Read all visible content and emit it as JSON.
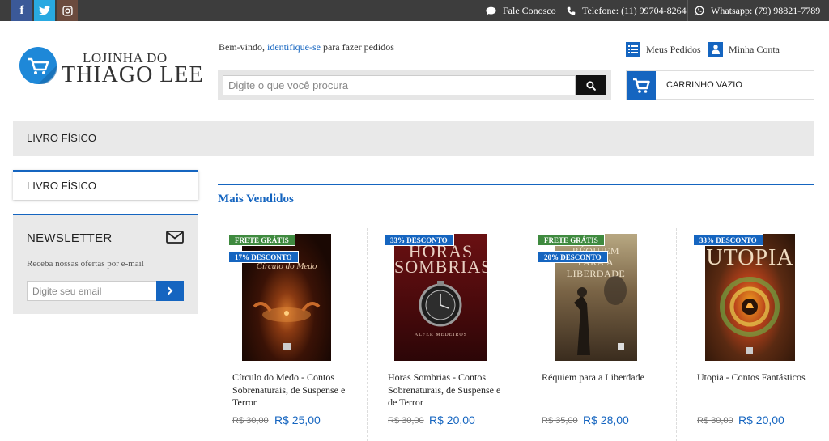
{
  "topbar": {
    "social": [
      "f",
      "twitter-icon",
      "instagram-icon"
    ],
    "contact_label": "Fale Conosco",
    "phone_label": "Telefone: (11) 99704-8264",
    "whatsapp_label": "Whatsapp: (79) 98821-7789"
  },
  "logo": {
    "line1": "LOJINHA DO",
    "line2": "THIAGO LEE"
  },
  "welcome": {
    "prefix": "Bem-vindo, ",
    "link": "identifique-se",
    "suffix": " para fazer pedidos"
  },
  "search": {
    "placeholder": "Digite o que você procura"
  },
  "account": {
    "orders_label": "Meus Pedidos",
    "account_label": "Minha Conta"
  },
  "cart": {
    "label": "CARRINHO VAZIO"
  },
  "category_bar": {
    "label": "LIVRO FÍSICO"
  },
  "sidebar": {
    "category_label": "LIVRO FÍSICO",
    "newsletter": {
      "title": "NEWSLETTER",
      "description": "Receba nossas ofertas por e-mail",
      "placeholder": "Digite seu email"
    }
  },
  "section": {
    "title": "Mais Vendidos"
  },
  "products": [
    {
      "name": "Círculo do Medo - Contos Sobrenaturais, de Suspense e Terror",
      "old_price": "R$ 30,00",
      "price": "R$ 25,00",
      "badges": [
        "FRETE GRÁTIS",
        "17% DESCONTO"
      ],
      "cover_title": "Círculo do Medo",
      "cover_color": "#2a0f06"
    },
    {
      "name": "Horas Sombrias - Contos Sobrenaturais, de Suspense e de Terror",
      "old_price": "R$ 30,00",
      "price": "R$ 20,00",
      "badges": [
        "33% DESCONTO"
      ],
      "cover_title": "HORAS SOMBRIAS",
      "cover_author": "ALFER MEDEIROS",
      "cover_color": "#5a0e10"
    },
    {
      "name": "Réquiem para a Liberdade",
      "old_price": "R$ 35,00",
      "price": "R$ 28,00",
      "badges": [
        "FRETE GRÁTIS",
        "20% DESCONTO"
      ],
      "cover_title": "RÉQUIEM PARA A LIBERDADE",
      "cover_color": "#5b4a35"
    },
    {
      "name": "Utopia - Contos Fantásticos",
      "old_price": "R$ 30,00",
      "price": "R$ 20,00",
      "badges": [
        "33% DESCONTO"
      ],
      "cover_title": "UTOPIA",
      "cover_color": "#3b1a0a"
    }
  ]
}
